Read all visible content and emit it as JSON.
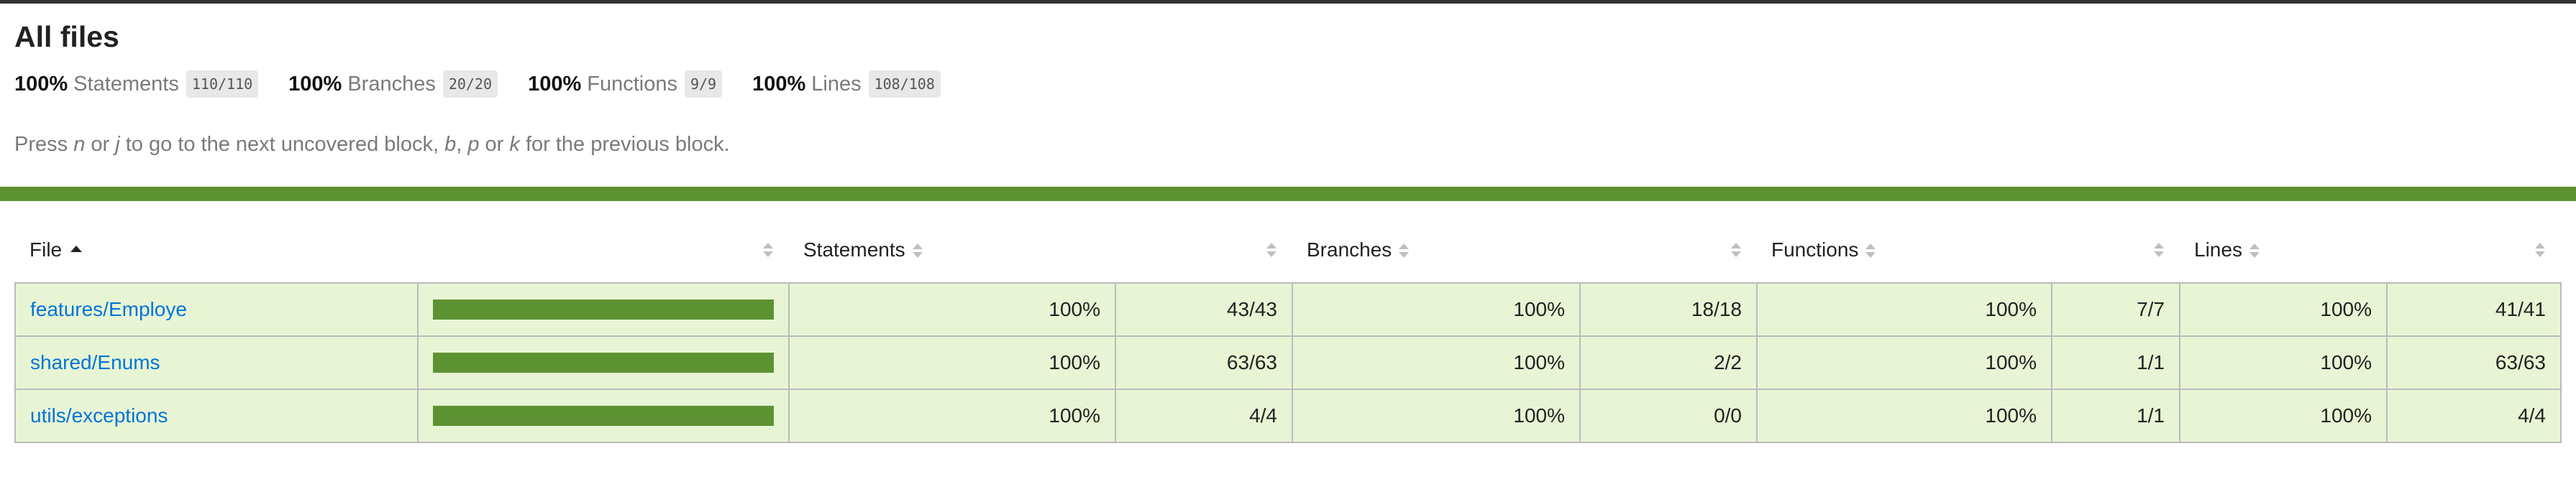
{
  "page": {
    "title": "All files"
  },
  "summary": [
    {
      "pct": "100%",
      "label": "Statements",
      "fraction": "110/110"
    },
    {
      "pct": "100%",
      "label": "Branches",
      "fraction": "20/20"
    },
    {
      "pct": "100%",
      "label": "Functions",
      "fraction": "9/9"
    },
    {
      "pct": "100%",
      "label": "Lines",
      "fraction": "108/108"
    }
  ],
  "hint": {
    "t1": "Press ",
    "k1": "n",
    "t2": " or ",
    "k2": "j",
    "t3": " to go to the next uncovered block, ",
    "k3": "b",
    "t4": ", ",
    "k4": "p",
    "t5": " or ",
    "k5": "k",
    "t6": " for the previous block."
  },
  "colors": {
    "high": "#5d9233",
    "row_bg": "#e8f5d4",
    "link": "#0074d9"
  },
  "table": {
    "headers": {
      "file": "File",
      "statements": "Statements",
      "branches": "Branches",
      "functions": "Functions",
      "lines": "Lines"
    },
    "sort": {
      "column": "File",
      "direction": "ascending"
    },
    "rows": [
      {
        "file": "features/Employe",
        "coverage": 1.0,
        "statements_pct": "100%",
        "statements": "43/43",
        "branches_pct": "100%",
        "branches": "18/18",
        "functions_pct": "100%",
        "functions": "7/7",
        "lines_pct": "100%",
        "lines": "41/41"
      },
      {
        "file": "shared/Enums",
        "coverage": 1.0,
        "statements_pct": "100%",
        "statements": "63/63",
        "branches_pct": "100%",
        "branches": "2/2",
        "functions_pct": "100%",
        "functions": "1/1",
        "lines_pct": "100%",
        "lines": "63/63"
      },
      {
        "file": "utils/exceptions",
        "coverage": 1.0,
        "statements_pct": "100%",
        "statements": "4/4",
        "branches_pct": "100%",
        "branches": "0/0",
        "functions_pct": "100%",
        "functions": "1/1",
        "lines_pct": "100%",
        "lines": "4/4"
      }
    ]
  }
}
